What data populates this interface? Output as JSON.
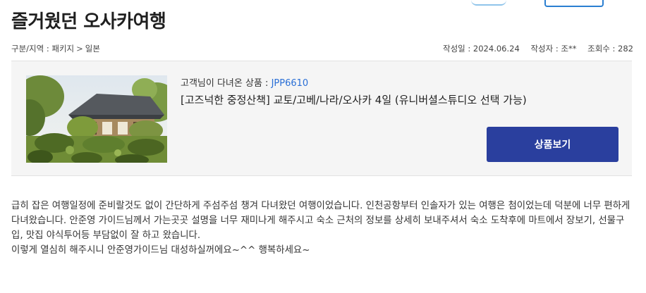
{
  "page": {
    "title": "즐거웠던 오사카여행"
  },
  "breadcrumb": {
    "category_label": "구분/지역 : 패키지",
    "separator": ">",
    "region": "일본"
  },
  "meta": {
    "date": "작성일 : 2024.06.24",
    "author": "작성자 : 조**",
    "views": "조회수 : 282"
  },
  "product": {
    "visited_label": "고객님이 다녀온 상품 : ",
    "code": "JPP6610",
    "name": "[고즈넉한 중정산책] 교토/고베/나라/오사카 4일 (유니버셜스튜디오 선택 가능)",
    "view_button": "상품보기"
  },
  "review": {
    "paragraph": "급히 잡은 여행일정에 준비랄것도 없이 간단하게 주섬주섬 챙겨 다녀왔던 여행이었습니다.  인천공항부터 인솔자가 있는 여행은 첨이었는데 덕분에 너무 편하게 다녀왔습니다.  안준영 가이드님께서 가는곳곳 설명을 너무 재미나게 해주시고 숙소 근처의 정보를 상세히 보내주셔서 숙소 도착후에 마트에서 장보기, 선물구입, 맛집 야식투어등 부담없이 잘 하고 왔습니다.",
    "closing": "이렇게 열심히 해주시니 안준영가이드님 대성하실꺼에요~^^ 행복하세요~"
  },
  "colors": {
    "button_bg": "#2a3f9e",
    "product_code": "#2a6fd6",
    "box_bg": "#f5f5f5"
  }
}
